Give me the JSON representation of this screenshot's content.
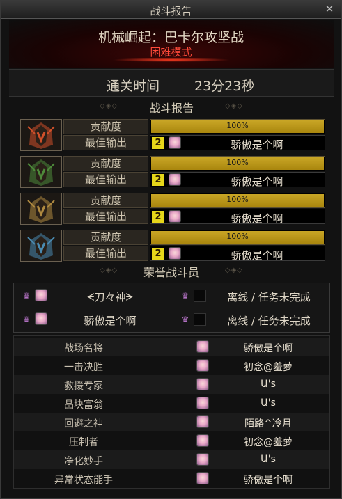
{
  "window": {
    "title": "战斗报告",
    "close_symbol": "✕"
  },
  "header": {
    "dungeon": "机械崛起：巴卡尔攻坚战",
    "difficulty": "困难模式",
    "clear_time_label": "通关时间",
    "clear_time_value": "23分23秒"
  },
  "battle_report": {
    "heading": "战斗报告",
    "contribution_label": "贡献度",
    "best_output_label": "最佳输出",
    "characters": [
      {
        "portrait": "fire-mech-portrait",
        "contribution": "100%",
        "contribution_fraction": 1.0,
        "level_badge": "2",
        "best_output": "骄傲是个啊"
      },
      {
        "portrait": "forest-mech-portrait",
        "contribution": "100%",
        "contribution_fraction": 1.0,
        "level_badge": "2",
        "best_output": "骄傲是个啊"
      },
      {
        "portrait": "earth-mech-portrait",
        "contribution": "100%",
        "contribution_fraction": 1.0,
        "level_badge": "2",
        "best_output": "骄傲是个啊"
      },
      {
        "portrait": "ice-mech-portrait",
        "contribution": "100%",
        "contribution_fraction": 1.0,
        "level_badge": "2",
        "best_output": "骄傲是个啊"
      }
    ]
  },
  "honor": {
    "heading": "荣誉战斗员",
    "members": [
      {
        "name": "ᗕ刀々神ᗒ",
        "has_avatar": true
      },
      {
        "name": "离线 / 任务未完成",
        "has_avatar": false
      },
      {
        "name": "骄傲是个啊",
        "has_avatar": true
      },
      {
        "name": "离线 / 任务未完成",
        "has_avatar": false
      }
    ]
  },
  "awards": [
    {
      "title": "战场名将",
      "name": "骄傲是个啊"
    },
    {
      "title": "一击决胜",
      "name": "初念@羞萝"
    },
    {
      "title": "救援专家",
      "name": "Ա's"
    },
    {
      "title": "晶块富翁",
      "name": "Ա's"
    },
    {
      "title": "回避之神",
      "name": "陌路^冷月"
    },
    {
      "title": "压制者",
      "name": "初念@羞萝"
    },
    {
      "title": "净化妙手",
      "name": "Ա's"
    },
    {
      "title": "异常状态能手",
      "name": "骄傲是个啊"
    }
  ],
  "colors": {
    "difficulty": "#ff4a3a",
    "contribution_bar": "#c9a626",
    "level_badge": "#e6d61a",
    "fire": "#d0502a",
    "forest": "#4e8a3a",
    "earth": "#b08a40",
    "ice": "#4a8ab0"
  }
}
